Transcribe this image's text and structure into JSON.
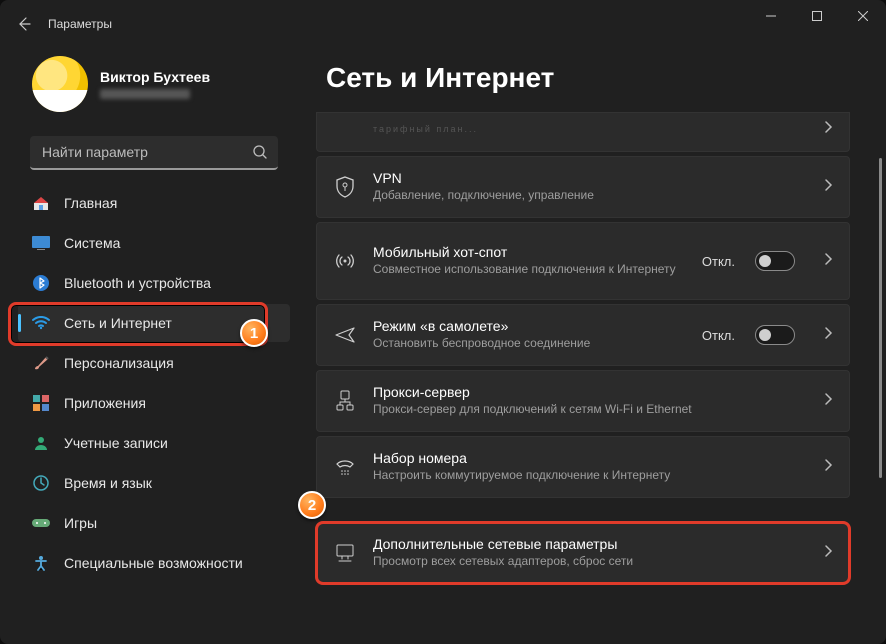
{
  "window": {
    "title": "Параметры"
  },
  "profile": {
    "name": "Виктор Бухтеев"
  },
  "search": {
    "placeholder": "Найти параметр"
  },
  "sidebar": {
    "items": [
      {
        "label": "Главная"
      },
      {
        "label": "Система"
      },
      {
        "label": "Bluetooth и устройства"
      },
      {
        "label": "Сеть и Интернет"
      },
      {
        "label": "Персонализация"
      },
      {
        "label": "Приложения"
      },
      {
        "label": "Учетные записи"
      },
      {
        "label": "Время и язык"
      },
      {
        "label": "Игры"
      },
      {
        "label": "Специальные возможности"
      }
    ]
  },
  "page": {
    "title": "Сеть и Интернет"
  },
  "cards": {
    "cutoff_sub": "··········· ·······",
    "vpn": {
      "title": "VPN",
      "sub": "Добавление, подключение, управление"
    },
    "hotspot": {
      "title": "Мобильный хот-спот",
      "sub": "Совместное использование подключения к Интернету",
      "state": "Откл."
    },
    "airplane": {
      "title": "Режим «в самолете»",
      "sub": "Остановить беспроводное соединение",
      "state": "Откл."
    },
    "proxy": {
      "title": "Прокси-сервер",
      "sub": "Прокси-сервер для подключений к сетям Wi-Fi и Ethernet"
    },
    "dialup": {
      "title": "Набор номера",
      "sub": "Настроить коммутируемое подключение к Интернету"
    },
    "advanced": {
      "title": "Дополнительные сетевые параметры",
      "sub": "Просмотр всех сетевых адаптеров, сброс сети"
    }
  },
  "badges": {
    "one": "1",
    "two": "2"
  }
}
